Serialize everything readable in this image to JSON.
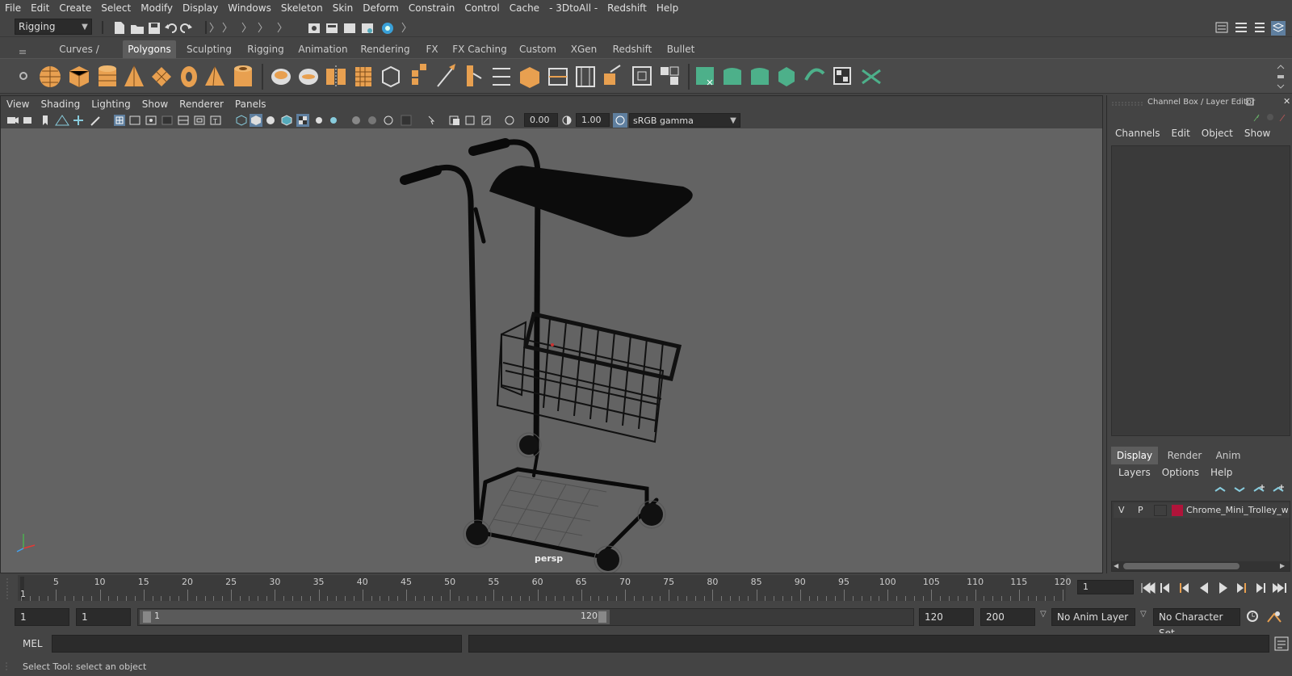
{
  "menubar": {
    "items": [
      "File",
      "Edit",
      "Create",
      "Select",
      "Modify",
      "Display",
      "Windows",
      "Skeleton",
      "Skin",
      "Deform",
      "Constrain",
      "Control",
      "Cache",
      "- 3DtoAll -",
      "Redshift",
      "Help"
    ]
  },
  "statusline": {
    "menuset": "Rigging"
  },
  "shelf": {
    "tabs": [
      "Curves / Surfaces",
      "Polygons",
      "Sculpting",
      "Rigging",
      "Animation",
      "Rendering",
      "FX",
      "FX Caching",
      "Custom",
      "XGen",
      "Redshift",
      "Bullet"
    ],
    "active_tab": "Polygons",
    "accent_orange": "#e8a050",
    "accent_green": "#4db08a"
  },
  "viewport": {
    "menu": [
      "View",
      "Shading",
      "Lighting",
      "Show",
      "Renderer",
      "Panels"
    ],
    "exposure": "0.00",
    "gamma": "1.00",
    "colorspace": "sRGB gamma",
    "camera": "persp"
  },
  "channelbox": {
    "title": "Channel Box / Layer Editor",
    "menu": [
      "Channels",
      "Edit",
      "Object",
      "Show"
    ],
    "layer_tabs": [
      "Display",
      "Render",
      "Anim"
    ],
    "active_layer_tab": "Display",
    "layer_menu": [
      "Layers",
      "Options",
      "Help"
    ],
    "layer": {
      "v": "V",
      "p": "P",
      "name": "Chrome_Mini_Trolley_wit",
      "color": "#b0143a"
    }
  },
  "timeslider": {
    "labels": [
      "5",
      "10",
      "15",
      "20",
      "25",
      "30",
      "35",
      "40",
      "45",
      "50",
      "55",
      "60",
      "65",
      "70",
      "75",
      "80",
      "85",
      "90",
      "95",
      "100",
      "105",
      "110",
      "115",
      "120"
    ],
    "current_marker": "1",
    "current_frame": "1"
  },
  "range": {
    "start": "1",
    "playback_start": "1",
    "slider_start": "1",
    "slider_end": "120",
    "playback_end": "120",
    "end": "200",
    "anim_layer": "No Anim Layer",
    "character_set": "No Character Set"
  },
  "cmdline": {
    "label": "MEL"
  },
  "helpline": {
    "text": "Select Tool: select an object"
  }
}
